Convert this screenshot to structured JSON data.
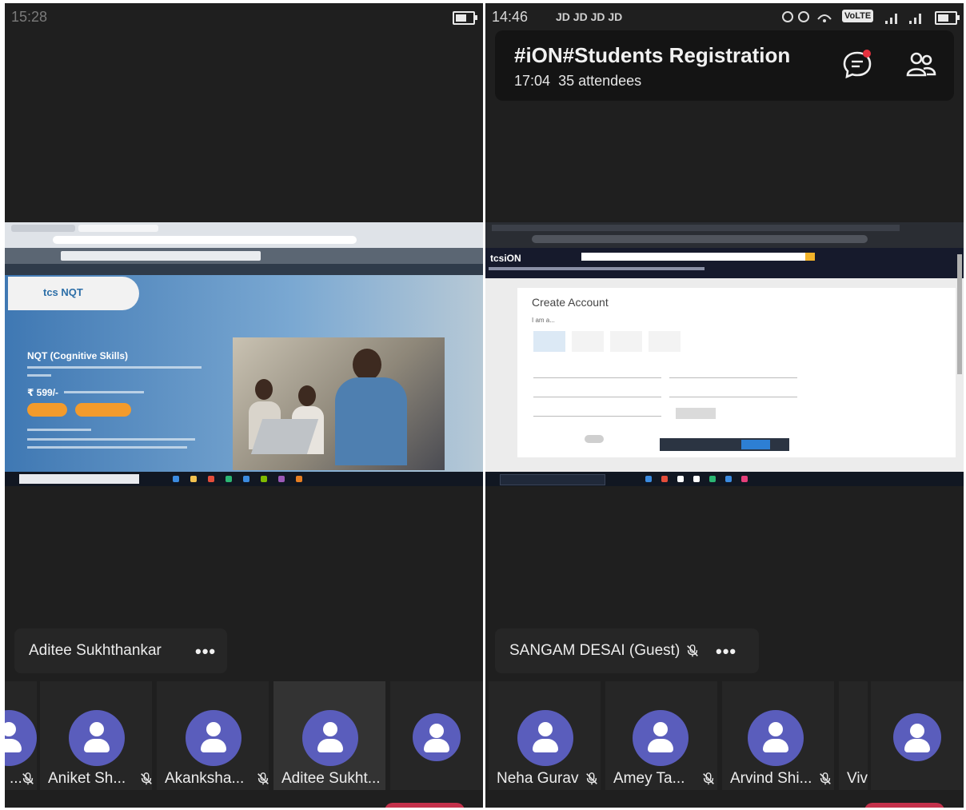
{
  "left": {
    "time": "15:28",
    "presenter_name": "Aditee Sukhthankar",
    "participants": [
      {
        "name": "...",
        "muted": true
      },
      {
        "name": "Aniket Sh...",
        "muted": true
      },
      {
        "name": "Akanksha...",
        "muted": true
      },
      {
        "name": "Aditee Sukht...",
        "muted": false
      },
      {
        "name": "",
        "muted": false
      }
    ],
    "share": {
      "logo_text": "tcs NQT",
      "title": "NQT (Cognitive Skills)",
      "price": "₹ 599/-"
    }
  },
  "right": {
    "status_time": "14:46",
    "status_carriers": "JD JD JD JD",
    "volte": "VoLTE",
    "meeting_title": "#iON#Students Registration",
    "meeting_elapsed": "17:04",
    "attendees": "35 attendees",
    "presenter_name": "SANGAM DESAI (Guest)",
    "participants": [
      {
        "name": "Neha Gurav",
        "muted": true
      },
      {
        "name": "Amey Ta...",
        "muted": true
      },
      {
        "name": "Arvind Shi...",
        "muted": true
      },
      {
        "name": "Viv",
        "muted": false
      },
      {
        "name": "",
        "muted": false
      }
    ],
    "share": {
      "site_logo": "tcsiON",
      "form_title": "Create Account",
      "form_subtitle": "I am a..."
    }
  },
  "colors": {
    "avatar": "#5a5dbc",
    "end_call": "#c4314b",
    "panel_bg": "#1f1f1f",
    "chat_badge": "#e5323f"
  }
}
